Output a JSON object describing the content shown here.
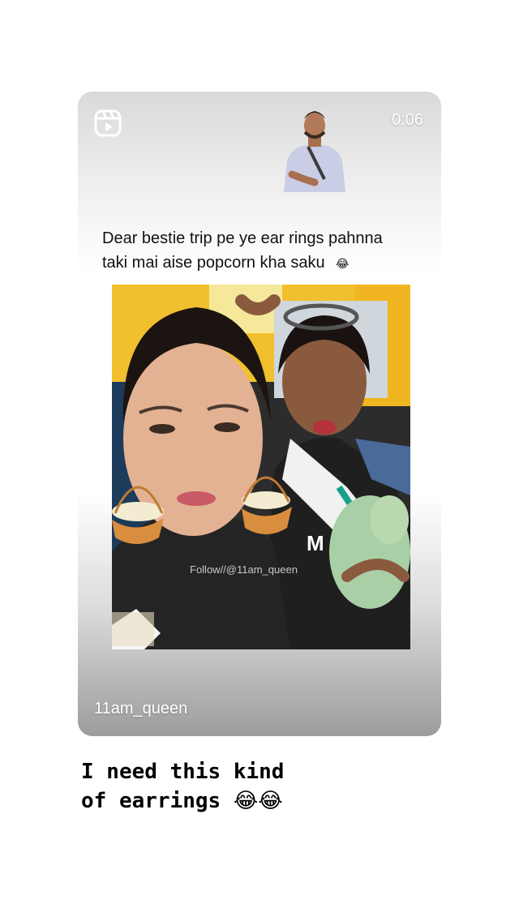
{
  "post": {
    "duration": "0:06",
    "caption_line1": "Dear bestie trip pe ye ear rings pahnna",
    "caption_line2": "taki mai aise popcorn kha saku",
    "caption_emoji": "😂",
    "watermark": "Follow//@11am_queen",
    "username": "11am_queen",
    "icons": {
      "reels": "reels-icon"
    }
  },
  "story": {
    "caption_line1": "I need this kind",
    "caption_line2": "of earrings",
    "caption_emoji": "😂😂"
  }
}
